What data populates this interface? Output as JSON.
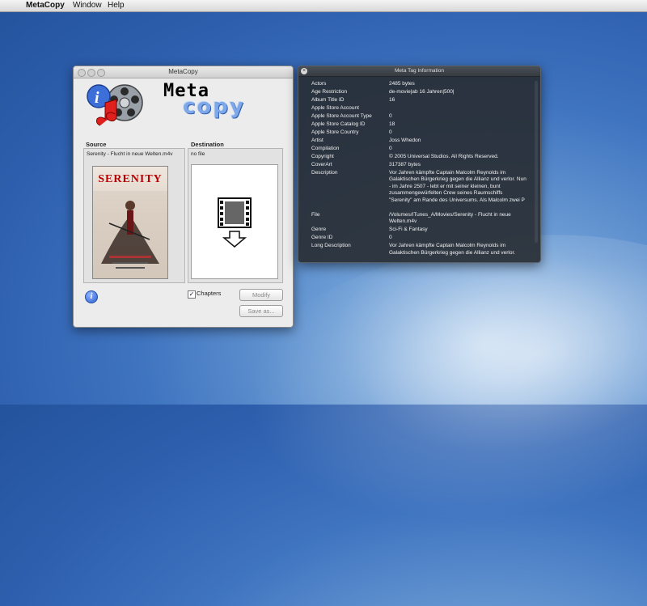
{
  "menubar": {
    "app_name": "MetaCopy",
    "items": [
      "Window",
      "Help"
    ]
  },
  "window": {
    "title": "MetaCopy",
    "logo_meta": "Meta",
    "logo_copy": "copy",
    "source_label": "Source",
    "destination_label": "Destination",
    "source_file": "Serenity - Flucht in neue Welten.m4v",
    "destination_file": "no file",
    "poster_title": "SERENITY",
    "chapters_label": "Chapters",
    "chapters_checked": true,
    "modify_label": "Modify",
    "save_as_label": "Save as...",
    "info_glyph": "i"
  },
  "meta_panel": {
    "title": "Meta Tag Information",
    "rows": [
      {
        "key": "Actors",
        "value": "2485 bytes"
      },
      {
        "key": "Age Restriction",
        "value": "de-movie|ab 16 Jahren|500|"
      },
      {
        "key": "Album Title ID",
        "value": "16"
      },
      {
        "key": "Apple Store Account",
        "value": ""
      },
      {
        "key": "Apple Store Account Type",
        "value": "0"
      },
      {
        "key": "Apple Store Catalog ID",
        "value": "18"
      },
      {
        "key": "Apple Store Country",
        "value": "0"
      },
      {
        "key": "Artist",
        "value": "Joss Whedon"
      },
      {
        "key": "Compilation",
        "value": "0"
      },
      {
        "key": "Copyright",
        "value": "© 2005 Universal Studios. All Rights Reserved."
      },
      {
        "key": "CoverArt",
        "value": "317387 bytes"
      },
      {
        "key": "Description",
        "value": "Vor Jahren kämpfte Captain Malcolm Reynolds im Galaktischen Bürgerkrieg gegen die Allianz und verlor. Nun - im Jahre 2507 - lebt er mit seiner kleinen, bunt zusammengewürfelten Crew seines Raumschiffs \"Serenity\" am Rande des Universums. Als Malcolm zwei P"
      },
      {
        "key": "File",
        "value": "/Volumes/ITunes_A/Movies/Serenity - Flucht in neue Welten.m4v"
      },
      {
        "key": "Genre",
        "value": "Sci-Fi & Fantasy"
      },
      {
        "key": "Genre ID",
        "value": "0"
      },
      {
        "key": "Long Description",
        "value": "Vor Jahren kämpfte Captain Malcolm Reynolds im Galaktischen Bürgerkrieg gegen die Allianz und verlor."
      }
    ]
  }
}
